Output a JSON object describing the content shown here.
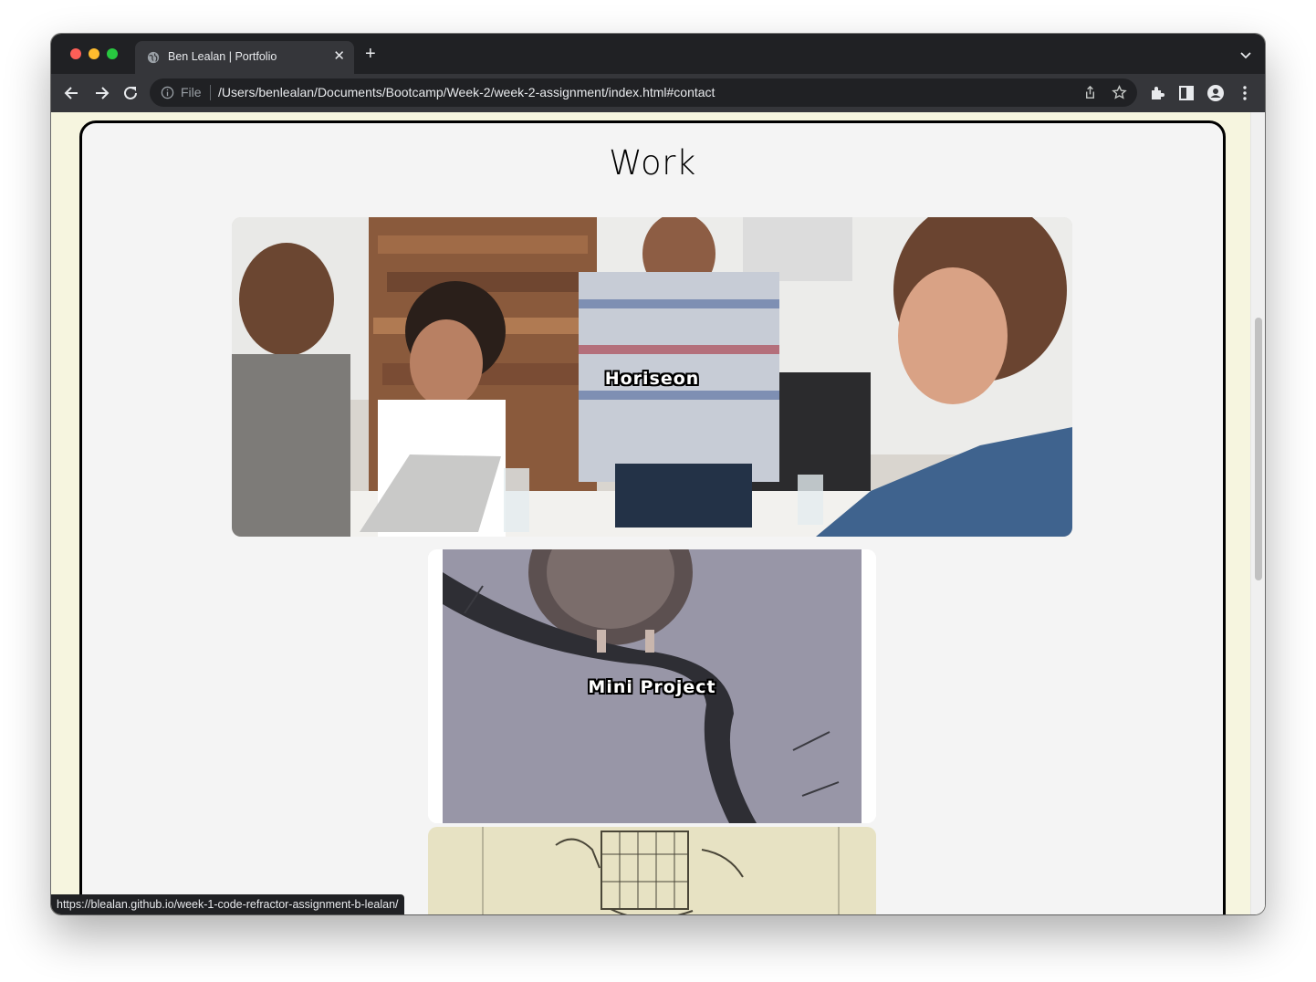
{
  "browser": {
    "tab_title": "Ben Lealan | Portfolio",
    "url_scheme": "File",
    "url": "/Users/benlealan/Documents/Bootcamp/Week-2/week-2-assignment/index.html#contact",
    "status_url": "https://blealan.github.io/week-1-code-refractor-assignment-b-lealan/",
    "icons": [
      "globe-icon",
      "close-icon",
      "plus-icon",
      "chevron-down-icon",
      "back-arrow-icon",
      "forward-arrow-icon",
      "reload-icon",
      "info-icon",
      "share-icon",
      "star-icon",
      "extensions-icon",
      "side-panel-icon",
      "profile-icon",
      "kebab-menu-icon"
    ]
  },
  "page": {
    "section_title": "Work",
    "projects": [
      {
        "label": "Horiseon",
        "image": "team-meeting-photo"
      },
      {
        "label": "Mini Project",
        "image": "owl-on-branch-print"
      },
      {
        "label": "",
        "image": "vintage-patent-drawing"
      }
    ]
  },
  "colors": {
    "page_background": "#f6f5df",
    "card_background": "#f4f4f4",
    "card_border": "#000000",
    "browser_chrome": "#202124"
  }
}
